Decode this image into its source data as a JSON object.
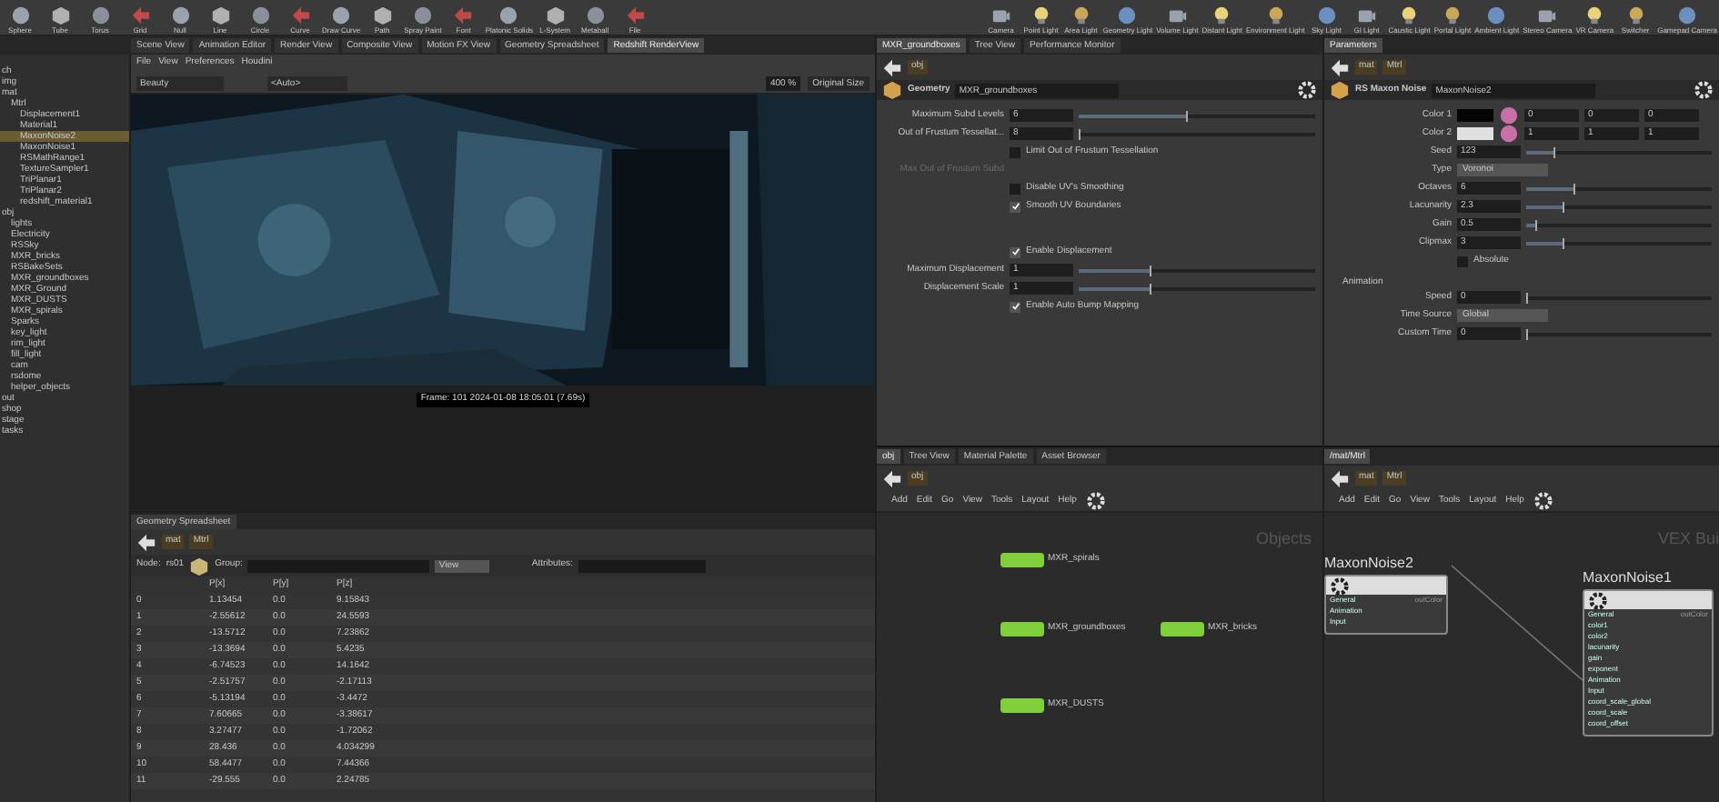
{
  "shelf": {
    "left_tools": [
      "Sphere",
      "Tube",
      "Torus",
      "Grid",
      "Null",
      "Line",
      "Circle",
      "Curve",
      "Draw Curve",
      "Path",
      "Spray Paint",
      "Font",
      "Platonic Solids",
      "L-System",
      "Metaball",
      "File"
    ],
    "right_tools": [
      "Camera",
      "Point Light",
      "Area Light",
      "Geometry Light",
      "Volume Light",
      "Distant Light",
      "Environment Light",
      "Sky Light",
      "GI Light",
      "Caustic Light",
      "Portal Light",
      "Ambient Light",
      "Stereo Camera",
      "VR Camera",
      "Switcher",
      "Gamepad Camera"
    ]
  },
  "viewer_pane": {
    "tabs": [
      {
        "label": "Scene View",
        "selected": false
      },
      {
        "label": "Animation Editor",
        "selected": false
      },
      {
        "label": "Render View",
        "selected": false
      },
      {
        "label": "Composite View",
        "selected": false
      },
      {
        "label": "Motion FX View",
        "selected": false
      },
      {
        "label": "Geometry Spreadsheet",
        "selected": false
      },
      {
        "label": "Redshift RenderView",
        "selected": true
      }
    ],
    "menu": [
      "File",
      "View",
      "Preferences",
      "Houdini"
    ],
    "aov": "Beauty",
    "camera": "<Auto>",
    "zoom": "400 %",
    "size_mode": "Original Size",
    "render_status": "Frame: 101  2024-01-08 18:05:01 (7.69s)"
  },
  "scene_tree": {
    "items": [
      {
        "label": "ch",
        "selected": false
      },
      {
        "label": "img",
        "selected": false
      },
      {
        "label": "mat",
        "selected": false,
        "children": [
          {
            "label": "Mtrl",
            "selected": false,
            "children": [
              {
                "label": "Displacement1",
                "selected": false
              },
              {
                "label": "Material1",
                "selected": false
              },
              {
                "label": "MaxonNoise2",
                "selected": true
              },
              {
                "label": "MaxonNoise1",
                "selected": false
              },
              {
                "label": "RSMathRange1",
                "selected": false
              },
              {
                "label": "TextureSampler1",
                "selected": false
              },
              {
                "label": "TriPlanar1",
                "selected": false
              },
              {
                "label": "TriPlanar2",
                "selected": false
              },
              {
                "label": "redshift_material1",
                "selected": false
              }
            ]
          }
        ]
      },
      {
        "label": "obj",
        "selected": false,
        "children": [
          {
            "label": "lights",
            "selected": false
          },
          {
            "label": "Electricity",
            "selected": false
          },
          {
            "label": "RSSky",
            "selected": false
          },
          {
            "label": "MXR_bricks",
            "selected": false
          },
          {
            "label": "RSBakeSets",
            "selected": false
          },
          {
            "label": "MXR_groundboxes",
            "selected": false
          },
          {
            "label": "MXR_Ground",
            "selected": false
          },
          {
            "label": "MXR_DUSTS",
            "selected": false
          },
          {
            "label": "MXR_spirals",
            "selected": false
          },
          {
            "label": "Sparks",
            "selected": false
          },
          {
            "label": "key_light",
            "selected": false
          },
          {
            "label": "rim_light",
            "selected": false
          },
          {
            "label": "fill_light",
            "selected": false
          },
          {
            "label": "cam",
            "selected": false
          },
          {
            "label": "rsdome",
            "selected": false
          },
          {
            "label": "helper_objects",
            "selected": false
          }
        ]
      },
      {
        "label": "out",
        "selected": false
      },
      {
        "label": "shop",
        "selected": false
      },
      {
        "label": "stage",
        "selected": false
      },
      {
        "label": "tasks",
        "selected": false
      }
    ]
  },
  "spreadsheet": {
    "tab": "Geometry Spreadsheet",
    "path": [
      "mat",
      "Mtrl"
    ],
    "node_label": "Node:",
    "node": "rs01",
    "group_label": "Group:",
    "view": "View",
    "attributes_label": "Attributes:",
    "columns": [
      "",
      "P[x]",
      "P[y]",
      "P[z]"
    ],
    "rows": [
      [
        "0",
        "1.13454",
        "0.0",
        "9.15843"
      ],
      [
        "1",
        "-2.55612",
        "0.0",
        "24.5593"
      ],
      [
        "2",
        "-13.5712",
        "0.0",
        "7.23862"
      ],
      [
        "3",
        "-13.3694",
        "0.0",
        "5.4235"
      ],
      [
        "4",
        "-6.74523",
        "0.0",
        "14.1642"
      ],
      [
        "5",
        "-2.51757",
        "0.0",
        "-2.17113"
      ],
      [
        "6",
        "-5.13194",
        "0.0",
        "-3.4472"
      ],
      [
        "7",
        "7.60665",
        "0.0",
        "-3.38617"
      ],
      [
        "8",
        "3.27477",
        "0.0",
        "-1.72062"
      ],
      [
        "9",
        "28.436",
        "0.0",
        "4.034299"
      ],
      [
        "10",
        "58.4477",
        "0.0",
        "7.44366"
      ],
      [
        "11",
        "-29.555",
        "0.0",
        "2.24785"
      ]
    ]
  },
  "geometry_params": {
    "tabs": [
      {
        "label": "MXR_groundboxes",
        "selected": true
      },
      {
        "label": "Tree View",
        "selected": false
      },
      {
        "label": "Performance Monitor",
        "selected": false
      }
    ],
    "path": "obj",
    "type": "Geometry",
    "node": "MXR_groundboxes",
    "rows": [
      {
        "kind": "number",
        "label": "Maximum Subd Levels",
        "value": "6",
        "level": 0.45
      },
      {
        "kind": "number",
        "label": "Out of Frustum Tessellat...",
        "value": "8",
        "level": 0
      },
      {
        "kind": "checkbox",
        "label": "Limit Out of Frustum Tessellation",
        "checked": false
      },
      {
        "kind": "label",
        "label": "Max Out of Frustum Subd",
        "disabled": true
      },
      {
        "kind": "checkbox",
        "label": "Disable UV's Smoothing",
        "checked": false
      },
      {
        "kind": "checkbox",
        "label": "Smooth UV Boundaries",
        "checked": true
      },
      {
        "kind": "gap"
      },
      {
        "kind": "checkbox",
        "label": "Enable Displacement",
        "checked": true
      },
      {
        "kind": "number",
        "label": "Maximum Displacement",
        "value": "1",
        "level": 0.3
      },
      {
        "kind": "number",
        "label": "Displacement Scale",
        "value": "1",
        "level": 0.3
      },
      {
        "kind": "checkbox",
        "label": "Enable Auto Bump Mapping",
        "checked": true
      }
    ]
  },
  "noise_params": {
    "tab": "Parameters",
    "path": [
      "mat",
      "Mtrl"
    ],
    "type": "RS Maxon Noise",
    "node": "MaxonNoise2",
    "rows": [
      {
        "kind": "color",
        "label": "Color 1",
        "color": "#050505",
        "values": [
          "0",
          "0",
          "0"
        ]
      },
      {
        "kind": "color",
        "label": "Color 2",
        "color": "#e0e0e0",
        "values": [
          "1",
          "1",
          "1"
        ]
      },
      {
        "kind": "number",
        "label": "Seed",
        "value": "123",
        "level": 0.15
      },
      {
        "kind": "menu",
        "label": "Type",
        "value": "Voronoi"
      },
      {
        "kind": "number",
        "label": "Octaves",
        "value": "6",
        "level": 0.25
      },
      {
        "kind": "number",
        "label": "Lacunarity",
        "value": "2.3",
        "level": 0.2
      },
      {
        "kind": "number",
        "label": "Gain",
        "value": "0.5",
        "level": 0.05
      },
      {
        "kind": "number",
        "label": "Clipmax",
        "value": "3",
        "level": 0.2
      },
      {
        "kind": "checkbox",
        "label": "Absolute",
        "checked": false
      },
      {
        "kind": "section",
        "label": "Animation"
      },
      {
        "kind": "number",
        "label": "Speed",
        "value": "0",
        "level": 0
      },
      {
        "kind": "menu",
        "label": "Time Source",
        "value": "Global"
      },
      {
        "kind": "number",
        "label": "Custom Time",
        "value": "0",
        "level": 0
      }
    ]
  },
  "object_network": {
    "tabs": [
      {
        "label": "obj",
        "selected": true
      },
      {
        "label": "Tree View",
        "selected": false
      },
      {
        "label": "Material Palette",
        "selected": false
      },
      {
        "label": "Asset Browser",
        "selected": false
      }
    ],
    "path": "obj",
    "menu": [
      "Add",
      "Edit",
      "Go",
      "View",
      "Tools",
      "Layout",
      "Help"
    ],
    "context": "Objects",
    "nodes": [
      {
        "label": "MXR_spirals"
      },
      {
        "label": "MXR_groundboxes"
      },
      {
        "label": "MXR_bricks"
      },
      {
        "label": "MXR_DUSTS"
      }
    ]
  },
  "vex_network": {
    "tab": "/mat/Mtrl",
    "path": [
      "mat",
      "Mtrl"
    ],
    "menu": [
      "Add",
      "Edit",
      "Go",
      "View",
      "Tools",
      "Layout",
      "Help"
    ],
    "context": "VEX Bui",
    "nodes": [
      {
        "title": "MaxonNoise2",
        "output": "outColor",
        "ports": [
          "General",
          "Animation",
          "Input"
        ]
      },
      {
        "title": "MaxonNoise1",
        "output": "outColor",
        "ports": [
          "General",
          "color1",
          "color2",
          "lacunarity",
          "gain",
          "exponent",
          "Animation",
          "Input",
          "coord_scale_global",
          "coord_scale",
          "coord_offset"
        ]
      }
    ]
  }
}
